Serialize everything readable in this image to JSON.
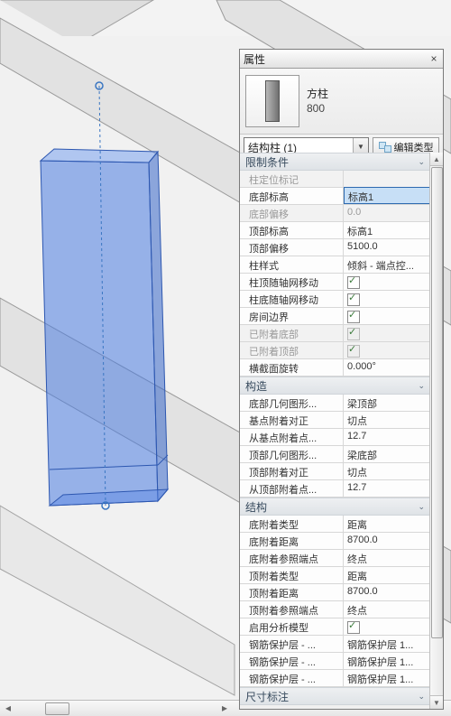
{
  "panel": {
    "title": "属性",
    "type_family": "方柱",
    "type_name": "800",
    "selector": "结构柱 (1)",
    "edit_type_label": "编辑类型"
  },
  "sections": {
    "constraints": {
      "title": "限制条件",
      "rows": [
        {
          "label": "柱定位标记",
          "value": "",
          "disabled": true
        },
        {
          "label": "底部标高",
          "value": "标高1",
          "selected": true
        },
        {
          "label": "底部偏移",
          "value": "0.0",
          "disabled": true
        },
        {
          "label": "顶部标高",
          "value": "标高1"
        },
        {
          "label": "顶部偏移",
          "value": "5100.0"
        },
        {
          "label": "柱样式",
          "value": "倾斜 - 端点控..."
        },
        {
          "label": "柱顶随轴网移动",
          "value": "",
          "check": true
        },
        {
          "label": "柱底随轴网移动",
          "value": "",
          "check": true
        },
        {
          "label": "房间边界",
          "value": "",
          "check": true
        },
        {
          "label": "已附着底部",
          "value": "",
          "check": true,
          "disabled": true
        },
        {
          "label": "已附着顶部",
          "value": "",
          "check": true,
          "disabled": true
        },
        {
          "label": "横截面旋转",
          "value": "0.000°"
        }
      ]
    },
    "construction": {
      "title": "构造",
      "rows": [
        {
          "label": "底部几何图形...",
          "value": "梁顶部"
        },
        {
          "label": "基点附着对正",
          "value": "切点"
        },
        {
          "label": "从基点附着点...",
          "value": "12.7"
        },
        {
          "label": "顶部几何图形...",
          "value": "梁底部"
        },
        {
          "label": "顶部附着对正",
          "value": "切点"
        },
        {
          "label": "从顶部附着点...",
          "value": "12.7"
        }
      ]
    },
    "structural": {
      "title": "结构",
      "rows": [
        {
          "label": "底附着类型",
          "value": "距离"
        },
        {
          "label": "底附着距离",
          "value": "8700.0"
        },
        {
          "label": "底附着参照端点",
          "value": "终点"
        },
        {
          "label": "顶附着类型",
          "value": "距离"
        },
        {
          "label": "顶附着距离",
          "value": "8700.0"
        },
        {
          "label": "顶附着参照端点",
          "value": "终点"
        },
        {
          "label": "启用分析模型",
          "value": "",
          "check": true
        },
        {
          "label": "钢筋保护层 - ...",
          "value": "钢筋保护层 1..."
        },
        {
          "label": "钢筋保护层 - ...",
          "value": "钢筋保护层 1..."
        },
        {
          "label": "钢筋保护层 - ...",
          "value": "钢筋保护层 1..."
        }
      ]
    },
    "dimensions": {
      "title": "尺寸标注",
      "rows": []
    }
  }
}
